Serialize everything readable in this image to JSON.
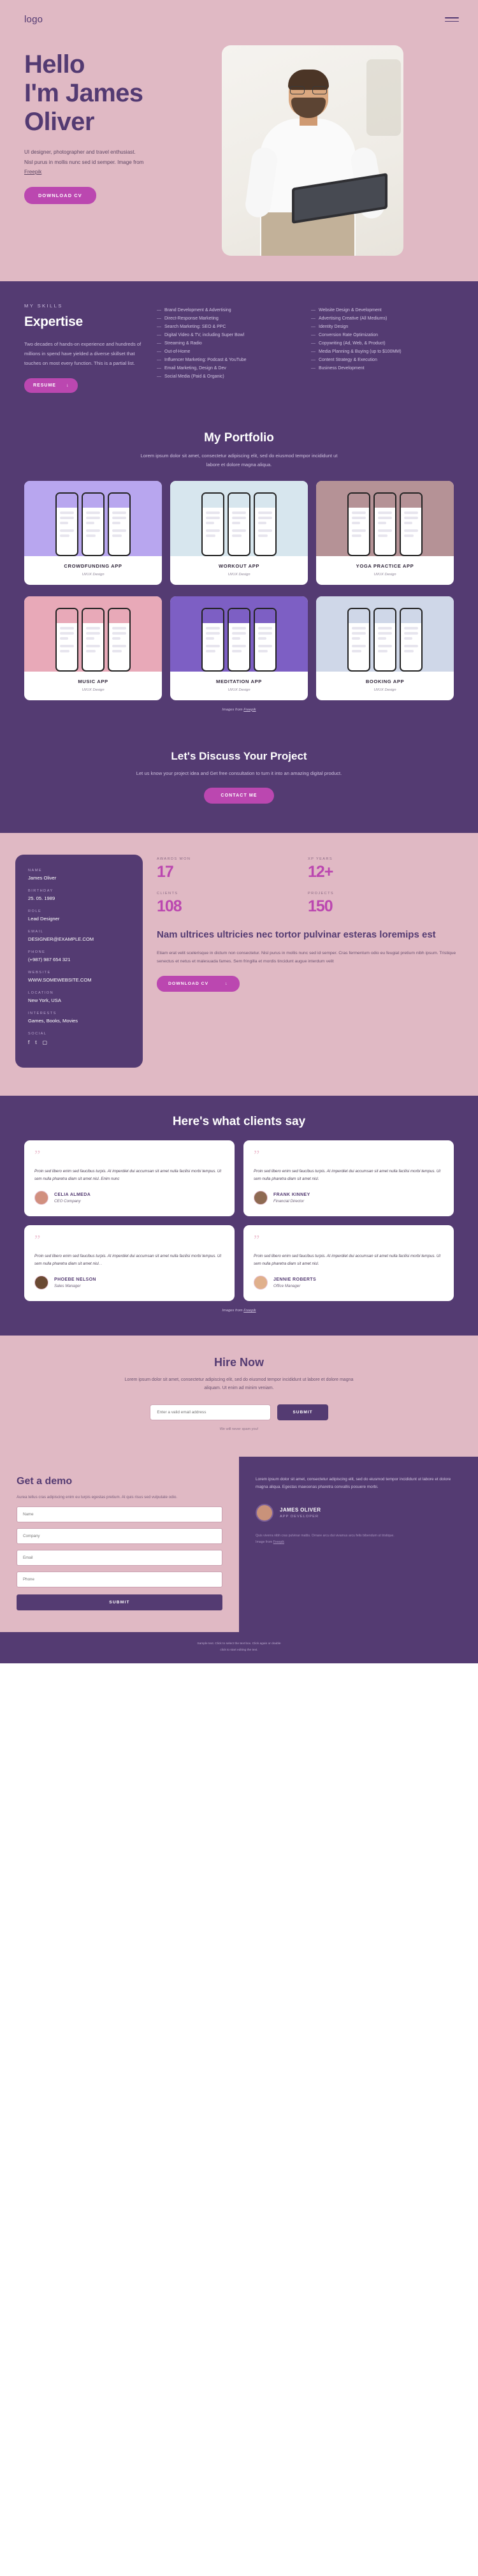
{
  "header": {
    "logo": "logo",
    "menu_icon": "hamburger-menu-icon"
  },
  "hero": {
    "title_line1": "Hello",
    "title_line2": "I'm James",
    "title_line3": "Oliver",
    "description": "UI designer, photographer and travel enthusiast. Nisl purus in mollis nunc sed id semper.  Image from ",
    "credit_link": "Freepik",
    "cta": "DOWNLOAD CV"
  },
  "expertise": {
    "eyebrow": "MY SKILLS",
    "title": "Expertise",
    "text": "Two decades of hands-on experience and hundreds of millions in spend have yielded a diverse skillset that touches on most every function. This is a partial list.",
    "button": "RESUME",
    "button_icon": "download-icon",
    "skills_left": [
      "Brand Development & Advertising",
      "Direct-Response Marketing",
      "Search Marketing: SEO & PPC",
      "Digital Video & TV, including Super Bowl",
      "Streaming & Radio",
      "Out-of-Home",
      "Influencer Marketing: Podcast & YouTube",
      "Email Marketing, Design & Dev",
      "Social Media (Paid & Organic)"
    ],
    "skills_right": [
      "Website Design & Development",
      "Advertising Creative (All Mediums)",
      "Identity Design",
      "Conversion Rate Optimization",
      "Copywriting (Ad, Web, & Product)",
      "Media Planning & Buying (up to $100MM)",
      "Content Strategy & Execution",
      "Business Development"
    ]
  },
  "portfolio": {
    "title": "My Portfolio",
    "subtitle": "Lorem ipsum dolor sit amet, consectetur adipiscing elit, sed do eiusmod tempor incididunt ut labore et dolore magna aliqua.",
    "credit_prefix": "Images from ",
    "credit_link": "Freepik",
    "items": [
      {
        "title": "CROWDFUNDING APP",
        "sub": "UI/UX Design",
        "bg": "#b8a6ef"
      },
      {
        "title": "WORKOUT APP",
        "sub": "UI/UX Design",
        "bg": "#d7e6ee"
      },
      {
        "title": "YOGA PRACTICE APP",
        "sub": "UI/UX Design",
        "bg": "#b59296"
      },
      {
        "title": "MUSIC APP",
        "sub": "UI/UX Design",
        "bg": "#e8a9b8"
      },
      {
        "title": "MEDITATION APP",
        "sub": "UI/UX Design",
        "bg": "#7d5fc4"
      },
      {
        "title": "BOOKING  APP",
        "sub": "UI/UX Design",
        "bg": "#cfd7e8"
      }
    ]
  },
  "discuss": {
    "title": "Let's Discuss Your Project",
    "subtitle": "Let us know your project idea and Get free consultation to turn it into an amazing digital product.",
    "cta": "CONTACT ME"
  },
  "about": {
    "card": [
      {
        "label": "NAME",
        "value": "James Oliver"
      },
      {
        "label": "BIRTHDAY",
        "value": "25. 05. 1989"
      },
      {
        "label": "ROLE",
        "value": "Lead Designer"
      },
      {
        "label": "EMAIL",
        "value": "DESIGNER@EXAMPLE.COM"
      },
      {
        "label": "PHONE",
        "value": "(+987) 987 654 321"
      },
      {
        "label": "WEBSITE",
        "value": "WWW.SOMEWEBSITE.COM"
      },
      {
        "label": "LOCATION",
        "value": "New York, USA"
      },
      {
        "label": "INTERESTS",
        "value": "Games, Books, Movies"
      },
      {
        "label": "SOCIAL",
        "value": ""
      }
    ],
    "socials": [
      "facebook-icon",
      "twitter-icon",
      "instagram-icon"
    ],
    "stats": [
      {
        "label": "AWARDS WON",
        "value": "17"
      },
      {
        "label": "XP YEARS",
        "value": "12+"
      },
      {
        "label": "CLIENTS",
        "value": "108"
      },
      {
        "label": "PROJECTS",
        "value": "150"
      }
    ],
    "heading": "Nam ultrices ultricies nec tortor pulvinar esteras loremips est",
    "paragraph": "Etiam erat velit scelerisque in dictum non consectetur. Nisl purus in mollis nunc sed id semper. Cras fermentum odio eu feugiat pretium nibh ipsum. Tristique senectus et netus et malesuada fames. Sem fringilla et mordis tincidunt augue interdum velit",
    "cta": "DOWNLOAD CV",
    "cta_icon": "download-icon"
  },
  "testimonials": {
    "title": "Here's what clients say",
    "credit_prefix": "Images from ",
    "credit_link": "Freepik",
    "items": [
      {
        "quote": "Proin sed libero enim sed faucibus turpis. At imperdiet dui accumsan sit amet nulla facilisi morbi tempus. Ut sem nulla pharetra diam sit amet nisl. Enim nunc",
        "name": "CELIA ALMEDA",
        "role": "CEO Company",
        "avatar_color": "#d1907f"
      },
      {
        "quote": "Proin sed libero enim sed faucibus turpis. At imperdiet dui accumsan sit amet nulla facilisi morbi tempus. Ut sem nulla pharetra diam sit amet nisl.",
        "name": "FRANK KINNEY",
        "role": "Financial Director",
        "avatar_color": "#8e6a52"
      },
      {
        "quote": "Proin sed libero enim sed faucibus turpis. At imperdiet dui accumsan sit amet nulla facilisi morbi tempus. Ut sem nulla pharetra diam sit amet nisl. .",
        "name": "PHOEBE NELSON",
        "role": "Sales Manager",
        "avatar_color": "#6b4a33"
      },
      {
        "quote": "Proin sed libero enim sed faucibus turpis. At imperdiet dui accumsan sit amet nulla facilisi morbi tempus. Ut sem nulla pharetra diam sit amet nisl.",
        "name": "JENNIE ROBERTS",
        "role": "Office Manager",
        "avatar_color": "#e0b08c"
      }
    ]
  },
  "hire": {
    "title": "Hire Now",
    "subtitle": "Lorem ipsum dolor sit amet, consectetur adipiscing elit, sed do eiusmod tempor incididunt ut labore et dolore magna aliquam. Ut enim ad minim veniam.",
    "email_placeholder": "Enter a valid email address",
    "submit": "SUBMIT",
    "note": "We will never spam you!"
  },
  "demo": {
    "title": "Get a demo",
    "subtitle": "Aurea tellus cras adipiscing enim eu turpis egestas pretium. At quis risus sed vulputate odio.",
    "fields": [
      {
        "placeholder": "Name"
      },
      {
        "placeholder": "Company"
      },
      {
        "placeholder": "Email"
      },
      {
        "placeholder": "Phone"
      }
    ],
    "submit": "SUBMIT",
    "right_text": "Lorem ipsum dolor sit amet, consectetur adipiscing elit, sed do eiusmod tempor incididunt ut labore et dolore magna aliqua. Egestas maecenas pharetra convallis posuere morbi.",
    "dev_name": "JAMES OLIVER",
    "dev_role": "APP DEVELOPER",
    "note": "Quis viverra nibh cras pulvinar mattis. Ornare arcu dui vivamus arcu felis bibendum ut tristique.",
    "note_credit_prefix": "Image from ",
    "note_credit_link": "Freepik"
  },
  "footer": {
    "line1": "Sample text. Click to select the text box. Click again or double",
    "line2": "click to start editing the text."
  },
  "colors": {
    "pink_bg": "#e0b9c4",
    "purple_bg": "#543b72",
    "accent": "#bb47b0"
  }
}
